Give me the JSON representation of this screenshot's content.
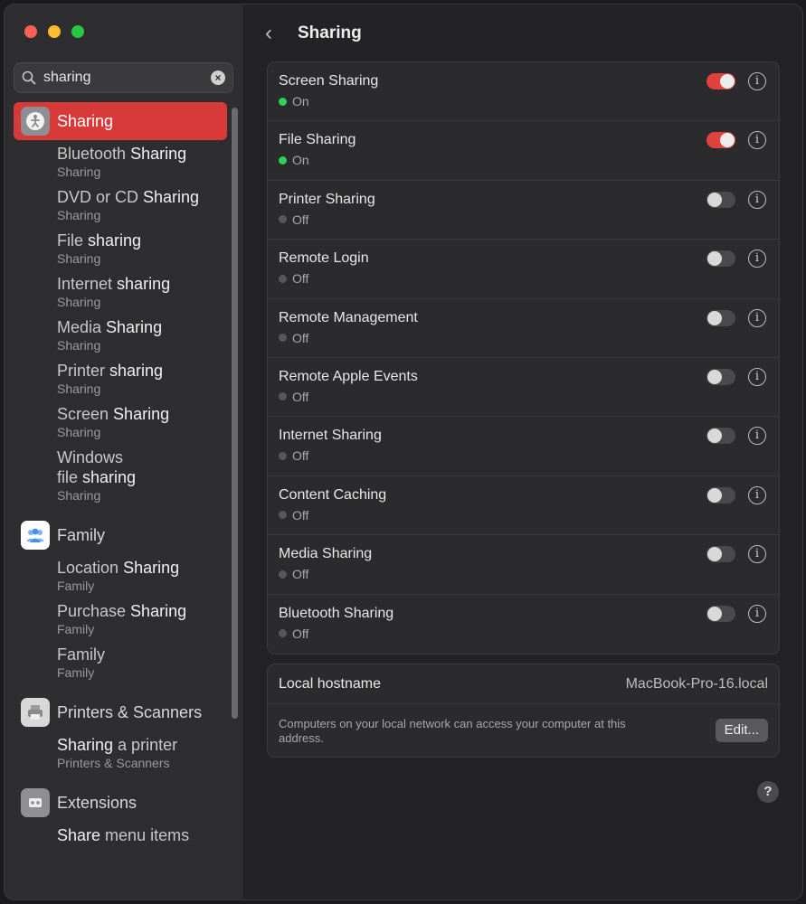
{
  "window": {
    "search": {
      "value": "sharing",
      "clear_label": "×"
    },
    "sidebar": {
      "categories": [
        {
          "label": "Sharing",
          "icon": "sharing-icon",
          "active": true,
          "items": [
            {
              "pre": "Bluetooth",
              "match": " Sharing",
              "post": "",
              "caption": "Sharing"
            },
            {
              "pre": "DVD or CD",
              "match": " Sharing",
              "post": "",
              "caption": "Sharing"
            },
            {
              "pre": "File",
              "match": " sharing",
              "post": "",
              "caption": "Sharing"
            },
            {
              "pre": "Internet",
              "match": " sharing",
              "post": "",
              "caption": "Sharing"
            },
            {
              "pre": "Media",
              "match": " Sharing",
              "post": "",
              "caption": "Sharing"
            },
            {
              "pre": "Printer",
              "match": " sharing",
              "post": "",
              "caption": "Sharing"
            },
            {
              "pre": "Screen",
              "match": " Sharing",
              "post": "",
              "caption": "Sharing"
            },
            {
              "pre": "Windows",
              "line2": "file",
              "match": " sharing",
              "post": "",
              "caption": "Sharing"
            }
          ]
        },
        {
          "label": "Family",
          "icon": "family-icon",
          "active": false,
          "items": [
            {
              "pre": "Location",
              "match": " Sharing",
              "post": "",
              "caption": "Family"
            },
            {
              "pre": "Purchase",
              "match": " Sharing",
              "post": "",
              "caption": "Family"
            },
            {
              "pre": "Family",
              "match": "",
              "post": "",
              "caption": "Family"
            }
          ]
        },
        {
          "label": "Printers & Scanners",
          "icon": "printer-icon",
          "active": false,
          "items": [
            {
              "pre": "",
              "match": "Sharing",
              "post": " a printer",
              "caption": "Printers & Scanners"
            }
          ]
        },
        {
          "label": "Extensions",
          "icon": "extensions-icon",
          "active": false,
          "items": [
            {
              "pre": "",
              "match": "Share",
              "post": " menu items",
              "caption": ""
            }
          ]
        }
      ]
    },
    "header": {
      "back_label": "‹",
      "title": "Sharing"
    },
    "services": [
      {
        "name": "Screen Sharing",
        "status": "On",
        "on": true
      },
      {
        "name": "File Sharing",
        "status": "On",
        "on": true
      },
      {
        "name": "Printer Sharing",
        "status": "Off",
        "on": false
      },
      {
        "name": "Remote Login",
        "status": "Off",
        "on": false
      },
      {
        "name": "Remote Management",
        "status": "Off",
        "on": false
      },
      {
        "name": "Remote Apple Events",
        "status": "Off",
        "on": false
      },
      {
        "name": "Internet Sharing",
        "status": "Off",
        "on": false
      },
      {
        "name": "Content Caching",
        "status": "Off",
        "on": false
      },
      {
        "name": "Media Sharing",
        "status": "Off",
        "on": false
      },
      {
        "name": "Bluetooth Sharing",
        "status": "Off",
        "on": false
      }
    ],
    "hostname": {
      "label": "Local hostname",
      "value": "MacBook-Pro-16.local",
      "description": "Computers on your local network can access your computer at this address.",
      "edit_label": "Edit..."
    },
    "help_label": "?",
    "info_label": "i",
    "colors": {
      "accent": "#d83a3a",
      "toggle_on": "#e0433f",
      "status_on": "#30d158",
      "status_off": "#58585a"
    }
  }
}
